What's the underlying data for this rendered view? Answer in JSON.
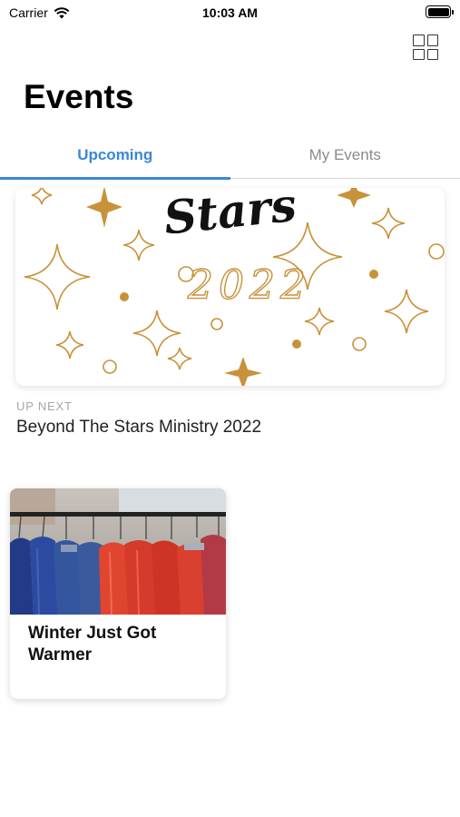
{
  "status_bar": {
    "carrier": "Carrier",
    "time": "10:03 AM",
    "battery_level": 1.0
  },
  "header": {
    "title": "Events",
    "grid_icon": "grid-view-icon"
  },
  "tabs": [
    {
      "label": "Upcoming",
      "active": true
    },
    {
      "label": "My Events",
      "active": false
    }
  ],
  "featured": {
    "banner_text": "Stars",
    "banner_year": "2022",
    "up_next_label": "UP NEXT",
    "title": "Beyond The Stars Ministry 2022"
  },
  "events": [
    {
      "title": "Winter Just Got Warmer",
      "image": "red-and-blue-jackets-on-rack"
    }
  ],
  "colors": {
    "accent": "#3a87d6",
    "gold": "#c8923a",
    "inactive_tab": "#8a8a8a"
  }
}
